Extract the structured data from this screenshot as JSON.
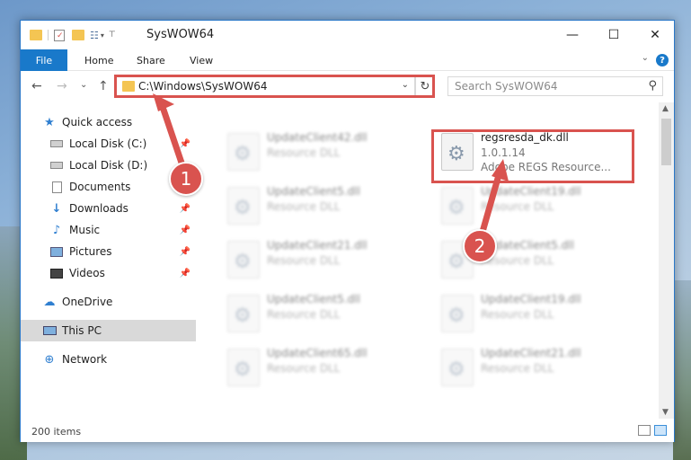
{
  "window": {
    "title": "SysWOW64",
    "minimize": "—",
    "maximize": "☐",
    "close": "✕"
  },
  "ribbon": {
    "tabs": [
      {
        "label": "File"
      },
      {
        "label": "Home"
      },
      {
        "label": "Share"
      },
      {
        "label": "View"
      }
    ]
  },
  "navbar": {
    "back": "←",
    "forward": "→",
    "recent": "⌄",
    "up": "↑",
    "address": "C:\\Windows\\SysWOW64",
    "refresh": "↻",
    "search_placeholder": "Search SysWOW64"
  },
  "sidebar": {
    "items": [
      {
        "label": "Quick access",
        "icon": "star-icon"
      },
      {
        "label": "Local Disk (C:)",
        "icon": "drive-icon"
      },
      {
        "label": "Local Disk (D:)",
        "icon": "drive-icon"
      },
      {
        "label": "Documents",
        "icon": "documents-icon"
      },
      {
        "label": "Downloads",
        "icon": "downloads-icon"
      },
      {
        "label": "Music",
        "icon": "music-icon"
      },
      {
        "label": "Pictures",
        "icon": "pictures-icon"
      },
      {
        "label": "Videos",
        "icon": "videos-icon"
      },
      {
        "label": "OneDrive",
        "icon": "cloud-icon"
      },
      {
        "label": "This PC",
        "icon": "computer-icon"
      },
      {
        "label": "Network",
        "icon": "network-icon"
      }
    ]
  },
  "files": {
    "left": [
      {
        "name": "UpdateClient42.dll",
        "type": "Resource DLL"
      },
      {
        "name": "UpdateClient5.dll",
        "type": "Resource DLL"
      },
      {
        "name": "UpdateClient21.dll",
        "type": "Resource DLL"
      },
      {
        "name": "UpdateClient5.dll",
        "type": "Resource DLL"
      },
      {
        "name": "UpdateClient65.dll",
        "type": "Resource DLL"
      }
    ],
    "right": [
      {
        "name": "regsresda_dk.dll",
        "version": "1.0.1.14",
        "type": "Adobe REGS Resource..."
      },
      {
        "name": "UpdateClient19.dll",
        "type": "Resource DLL"
      },
      {
        "name": "UpdateClient5.dll",
        "type": "Resource DLL"
      },
      {
        "name": "UpdateClient19.dll",
        "type": "Resource DLL"
      },
      {
        "name": "UpdateClient21.dll",
        "type": "Resource DLL"
      }
    ]
  },
  "status": {
    "count": "200 items"
  },
  "annotations": {
    "badge1": "1",
    "badge2": "2"
  },
  "colors": {
    "accent": "#1979ca",
    "highlight": "#d9534f"
  }
}
